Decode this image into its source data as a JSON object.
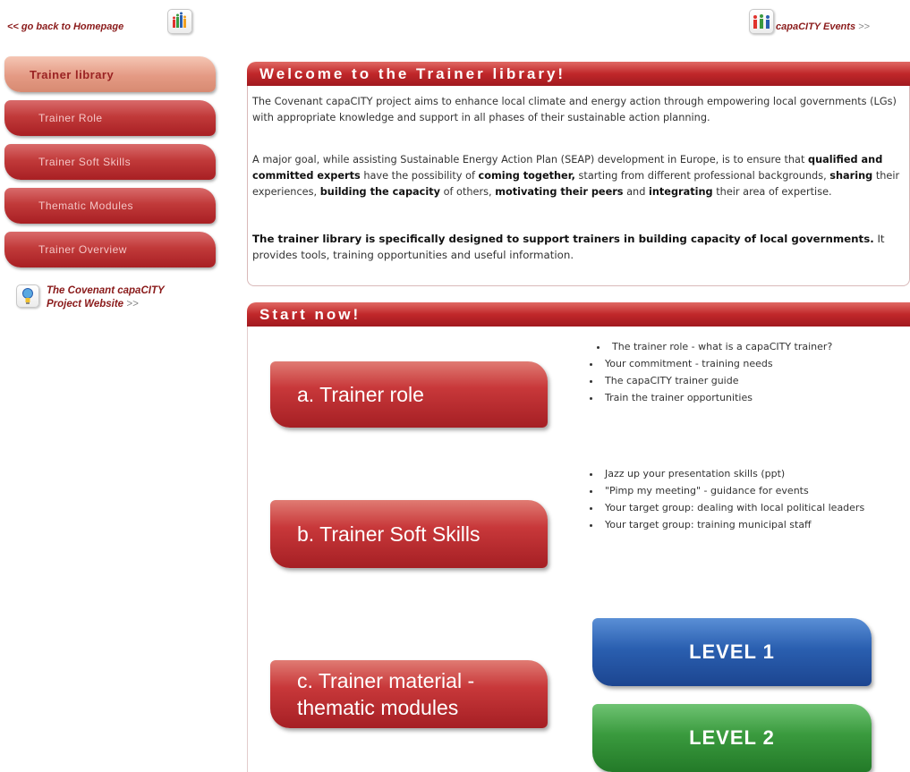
{
  "top": {
    "back_link": "<< go back to Homepage",
    "events_link": "capaCITY Events",
    "events_arrows": ">>"
  },
  "sidebar": {
    "items": [
      {
        "label": "Trainer library",
        "active": true
      },
      {
        "label": "Trainer Role",
        "active": false
      },
      {
        "label": "Trainer Soft Skills",
        "active": false
      },
      {
        "label": "Thematic Modules",
        "active": false
      },
      {
        "label": "Trainer Overview",
        "active": false
      }
    ],
    "website_link_line1": "The Covenant capaCITY",
    "website_link_line2": "Project Website",
    "website_link_arrows": ">>"
  },
  "welcome": {
    "title": "Welcome to the Trainer library!",
    "p1": "The Covenant capaCITY project aims to enhance local climate and energy action through empowering local governments (LGs) with appropriate knowledge and support in all phases of their sustainable action planning.",
    "p2": {
      "t1": "A major goal, while assisting Sustainable Energy Action Plan (SEAP) development in Europe, is to ensure that ",
      "b1": "qualified and committed experts",
      "t2": " have the possibility of ",
      "b2": "coming together,",
      "t3": " starting from different professional backgrounds, ",
      "b3": "sharing",
      "t4": " their experiences, ",
      "b4": "building the capacity",
      "t5": " of others, ",
      "b5": "motivating their peers",
      "t6": " and ",
      "b6": "integrating",
      "t7": " their area of expertise."
    },
    "p3": {
      "b1": "The trainer library is specifically designed to support trainers in building capacity of local governments.",
      "t1": " It provides tools, training opportunities and useful information."
    }
  },
  "start": {
    "title": "Start now!",
    "buttons": {
      "a": "a. Trainer role",
      "b": "b. Trainer Soft Skills",
      "c_line1": "c. Trainer material -",
      "c_line2": "thematic modules",
      "level1": "LEVEL 1",
      "level2": "LEVEL 2"
    },
    "list_a": [
      "The trainer role - what is a capaCITY trainer?",
      "Your commitment - training needs",
      "The capaCITY trainer guide",
      "Train the trainer opportunities"
    ],
    "list_b": [
      "Jazz up your presentation skills (ppt)",
      "\"Pimp my meeting\" - guidance for events",
      "Your target group: dealing with local political leaders",
      "Your target group: training municipal staff"
    ]
  },
  "colors": {
    "brand_red": "#b5262b",
    "level1_blue": "#2a5fb0",
    "level2_green": "#3a9a3e"
  }
}
